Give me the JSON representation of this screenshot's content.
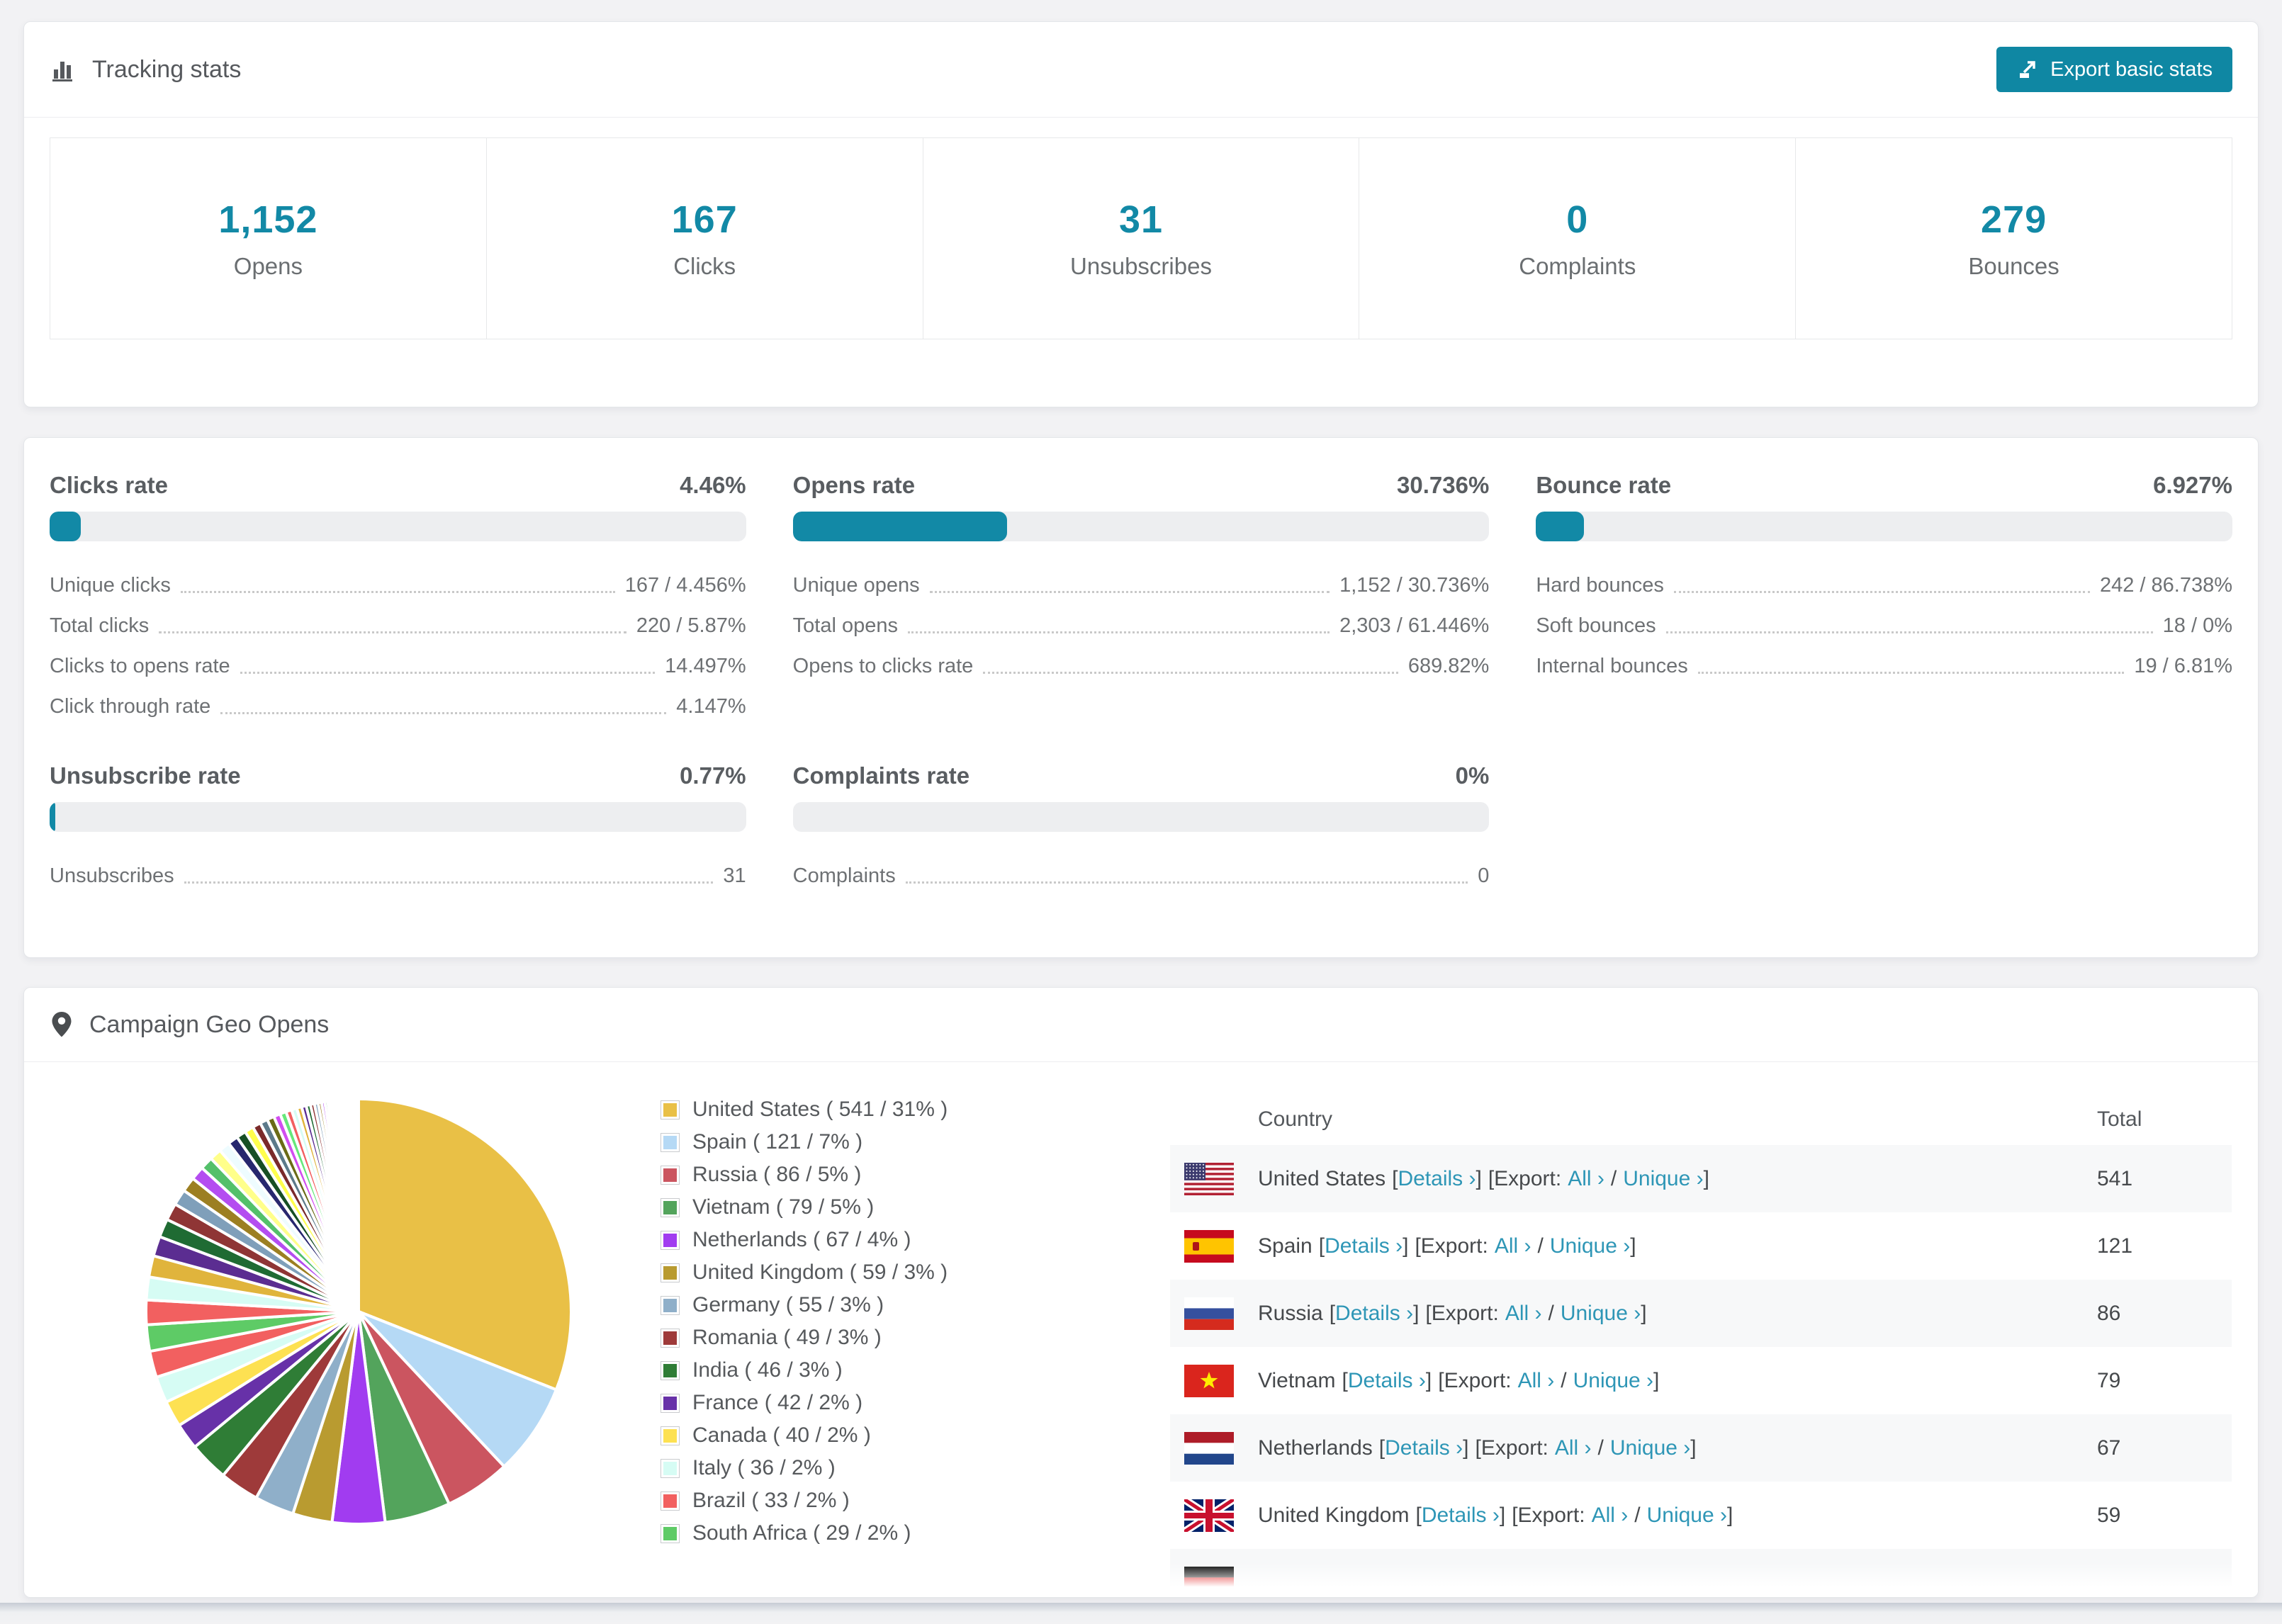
{
  "theme": {
    "accent_teal": "#1289a6",
    "button_teal": "#0f87a3",
    "link_teal": "#2e96b6",
    "progress_track": "#edeef0",
    "page_background": "#f2f2f4",
    "alt_row_background": "#f7f8f9"
  },
  "tracking": {
    "title": "Tracking stats",
    "export_label": "Export basic stats",
    "stats": [
      {
        "value": "1,152",
        "label": "Opens"
      },
      {
        "value": "167",
        "label": "Clicks"
      },
      {
        "value": "31",
        "label": "Unsubscribes"
      },
      {
        "value": "0",
        "label": "Complaints"
      },
      {
        "value": "279",
        "label": "Bounces"
      }
    ]
  },
  "rates": {
    "panels": [
      {
        "title": "Clicks rate",
        "value": "4.46%",
        "bar_pct": 4.46,
        "rows": [
          {
            "label": "Unique clicks",
            "value": "167 / 4.456%"
          },
          {
            "label": "Total clicks",
            "value": "220 / 5.87%"
          },
          {
            "label": "Clicks to opens rate",
            "value": "14.497%"
          },
          {
            "label": "Click through rate",
            "value": "4.147%"
          }
        ]
      },
      {
        "title": "Opens rate",
        "value": "30.736%",
        "bar_pct": 30.736,
        "rows": [
          {
            "label": "Unique opens",
            "value": "1,152 / 30.736%"
          },
          {
            "label": "Total opens",
            "value": "2,303 / 61.446%"
          },
          {
            "label": "Opens to clicks rate",
            "value": "689.82%"
          }
        ]
      },
      {
        "title": "Bounce rate",
        "value": "6.927%",
        "bar_pct": 6.927,
        "rows": [
          {
            "label": "Hard bounces",
            "value": "242 / 86.738%"
          },
          {
            "label": "Soft bounces",
            "value": "18 / 0%"
          },
          {
            "label": "Internal bounces",
            "value": "19 / 6.81%"
          }
        ]
      },
      {
        "title": "Unsubscribe rate",
        "value": "0.77%",
        "bar_pct": 0.77,
        "rows": [
          {
            "label": "Unsubscribes",
            "value": "31"
          }
        ]
      },
      {
        "title": "Complaints rate",
        "value": "0%",
        "bar_pct": 0,
        "rows": [
          {
            "label": "Complaints",
            "value": "0"
          }
        ]
      }
    ]
  },
  "geo": {
    "title": "Campaign Geo Opens",
    "chart_data": {
      "type": "pie",
      "title": "Campaign Geo Opens",
      "legend_position": "right",
      "slices": [
        {
          "name": "United States",
          "value": 541,
          "pct": 31,
          "color": "#e9c046"
        },
        {
          "name": "Spain",
          "value": 121,
          "pct": 7,
          "color": "#b5d9f5"
        },
        {
          "name": "Russia",
          "value": 86,
          "pct": 5,
          "color": "#cb5560"
        },
        {
          "name": "Vietnam",
          "value": 79,
          "pct": 5,
          "color": "#53a45c"
        },
        {
          "name": "Netherlands",
          "value": 67,
          "pct": 4,
          "color": "#a13cf0"
        },
        {
          "name": "United Kingdom",
          "value": 59,
          "pct": 3,
          "color": "#b99b30"
        },
        {
          "name": "Germany",
          "value": 55,
          "pct": 3,
          "color": "#8fafc9"
        },
        {
          "name": "Romania",
          "value": 49,
          "pct": 3,
          "color": "#9e3a3a"
        },
        {
          "name": "India",
          "value": 46,
          "pct": 3,
          "color": "#2f7d36"
        },
        {
          "name": "France",
          "value": 42,
          "pct": 2,
          "color": "#6731a8"
        },
        {
          "name": "Canada",
          "value": 40,
          "pct": 2,
          "color": "#fde152"
        },
        {
          "name": "Italy",
          "value": 36,
          "pct": 2,
          "color": "#d6fcf4"
        },
        {
          "name": "Brazil",
          "value": 33,
          "pct": 2,
          "color": "#f26060"
        },
        {
          "name": "South Africa",
          "value": 29,
          "pct": 2,
          "color": "#5ecb66"
        }
      ],
      "others": {
        "pct": 26,
        "slice_count": 50,
        "decay": 0.93,
        "palette": [
          "#f26060",
          "#d6fcf4",
          "#e0b43c",
          "#5b2d91",
          "#1f6b33",
          "#8f3535",
          "#7f9fba",
          "#9c7f22",
          "#b44df0",
          "#53c06a",
          "#ffff8a",
          "#eefcff",
          "#27276e",
          "#174f24",
          "#ffff4d",
          "#7a2a2a",
          "#5c7a8a",
          "#6b6b17",
          "#d14ef0",
          "#66e87a"
        ]
      }
    },
    "legend": [
      {
        "label": "United States ( 541 / 31% )",
        "color": "#e9c046"
      },
      {
        "label": "Spain ( 121 / 7% )",
        "color": "#b5d9f5"
      },
      {
        "label": "Russia ( 86 / 5% )",
        "color": "#cb5560"
      },
      {
        "label": "Vietnam ( 79 / 5% )",
        "color": "#53a45c"
      },
      {
        "label": "Netherlands ( 67 / 4% )",
        "color": "#a13cf0"
      },
      {
        "label": "United Kingdom ( 59 / 3% )",
        "color": "#b99b30"
      },
      {
        "label": "Germany ( 55 / 3% )",
        "color": "#8fafc9"
      },
      {
        "label": "Romania ( 49 / 3% )",
        "color": "#9e3a3a"
      },
      {
        "label": "India ( 46 / 3% )",
        "color": "#2f7d36"
      },
      {
        "label": "France ( 42 / 2% )",
        "color": "#6731a8"
      },
      {
        "label": "Canada ( 40 / 2% )",
        "color": "#fde152"
      },
      {
        "label": "Italy ( 36 / 2% )",
        "color": "#d6fcf4"
      },
      {
        "label": "Brazil ( 33 / 2% )",
        "color": "#f26060"
      },
      {
        "label": "South Africa ( 29 / 2% )",
        "color": "#5ecb66"
      }
    ],
    "table": {
      "headers": [
        "Country",
        "Total"
      ],
      "fmt": {
        "lb": "[",
        "rb": "]",
        "slash": "/",
        "details": "Details ›",
        "export": "Export:",
        "all": "All ›",
        "unique": "Unique ›"
      },
      "rows": [
        {
          "country": "United States",
          "flag": "us",
          "total": "541"
        },
        {
          "country": "Spain",
          "flag": "es",
          "total": "121"
        },
        {
          "country": "Russia",
          "flag": "ru",
          "total": "86"
        },
        {
          "country": "Vietnam",
          "flag": "vn",
          "total": "79"
        },
        {
          "country": "Netherlands",
          "flag": "nl",
          "total": "67"
        },
        {
          "country": "United Kingdom",
          "flag": "gb",
          "total": "59"
        }
      ],
      "partial_row": {
        "flag": "de"
      }
    }
  }
}
